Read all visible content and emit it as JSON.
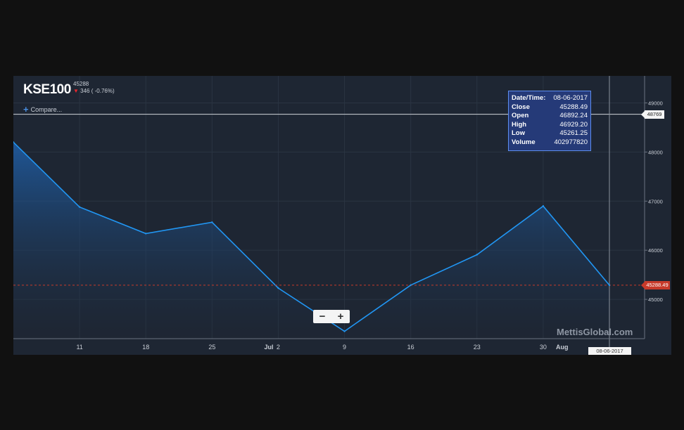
{
  "header": {
    "symbol": "KSE100",
    "last": "45288",
    "change": "346 ( -0.76%)"
  },
  "compare_label": "Compare...",
  "tooltip": {
    "rows": [
      {
        "label": "Date/Time:",
        "value": "08-06-2017"
      },
      {
        "label": "Close",
        "value": "45288.49"
      },
      {
        "label": "Open",
        "value": "46892.24"
      },
      {
        "label": "High",
        "value": "46929.20"
      },
      {
        "label": "Low",
        "value": "45261.25"
      },
      {
        "label": "Volume",
        "value": "402977820"
      }
    ]
  },
  "zoom": {
    "minus": "−",
    "plus": "+"
  },
  "watermark": "MettisGlobal.com",
  "crosshair_value": "48769",
  "close_value": "45288.49",
  "crosshair_date": "08-06-2017",
  "colors": {
    "line": "#2196f3",
    "close_line": "#c73a2a",
    "background": "#1e2633",
    "tooltip": "#253a78"
  },
  "chart_data": {
    "type": "area",
    "title": "KSE100",
    "x_ticks": [
      {
        "label": "11",
        "bold": false
      },
      {
        "label": "18",
        "bold": false
      },
      {
        "label": "25",
        "bold": false
      },
      {
        "label": "Jul",
        "bold": true
      },
      {
        "label": "2",
        "bold": false
      },
      {
        "label": "9",
        "bold": false
      },
      {
        "label": "16",
        "bold": false
      },
      {
        "label": "23",
        "bold": false
      },
      {
        "label": "30",
        "bold": false
      },
      {
        "label": "Aug",
        "bold": true
      }
    ],
    "y_ticks": [
      45000,
      46000,
      47000,
      48000,
      49000
    ],
    "ylim": [
      44200,
      49550
    ],
    "series": [
      {
        "x": [
          "2017-06-04",
          "2017-06-11",
          "2017-06-18",
          "2017-06-25",
          "2017-07-02",
          "2017-07-09",
          "2017-07-16",
          "2017-07-23",
          "2017-07-30",
          "2017-08-06"
        ],
        "y": [
          48200,
          46880,
          46340,
          46570,
          45230,
          44350,
          45290,
          45910,
          46900,
          45288.49
        ]
      }
    ],
    "grid": true,
    "close_line": 45288.49,
    "crosshair_y": 48769
  }
}
